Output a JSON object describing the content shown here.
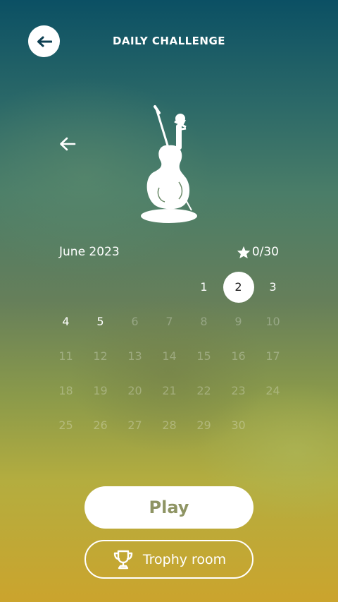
{
  "header": {
    "title": "DAILY CHALLENGE",
    "back_icon": "arrow-left-icon"
  },
  "challenge": {
    "image_icon": "violin-icon",
    "prev_icon": "arrow-left-icon"
  },
  "calendar": {
    "month": "June 2023",
    "stars": "0/30",
    "star_icon": "star-icon",
    "selected_day": "2",
    "active_days": [
      "1",
      "2",
      "3",
      "4",
      "5"
    ],
    "leading_blanks": 4,
    "days": [
      "1",
      "2",
      "3",
      "4",
      "5",
      "6",
      "7",
      "8",
      "9",
      "10",
      "11",
      "12",
      "13",
      "14",
      "15",
      "16",
      "17",
      "18",
      "19",
      "20",
      "21",
      "22",
      "23",
      "24",
      "25",
      "26",
      "27",
      "28",
      "29",
      "30"
    ]
  },
  "actions": {
    "play_label": "Play",
    "trophy_label": "Trophy room",
    "trophy_icon": "trophy-icon"
  }
}
